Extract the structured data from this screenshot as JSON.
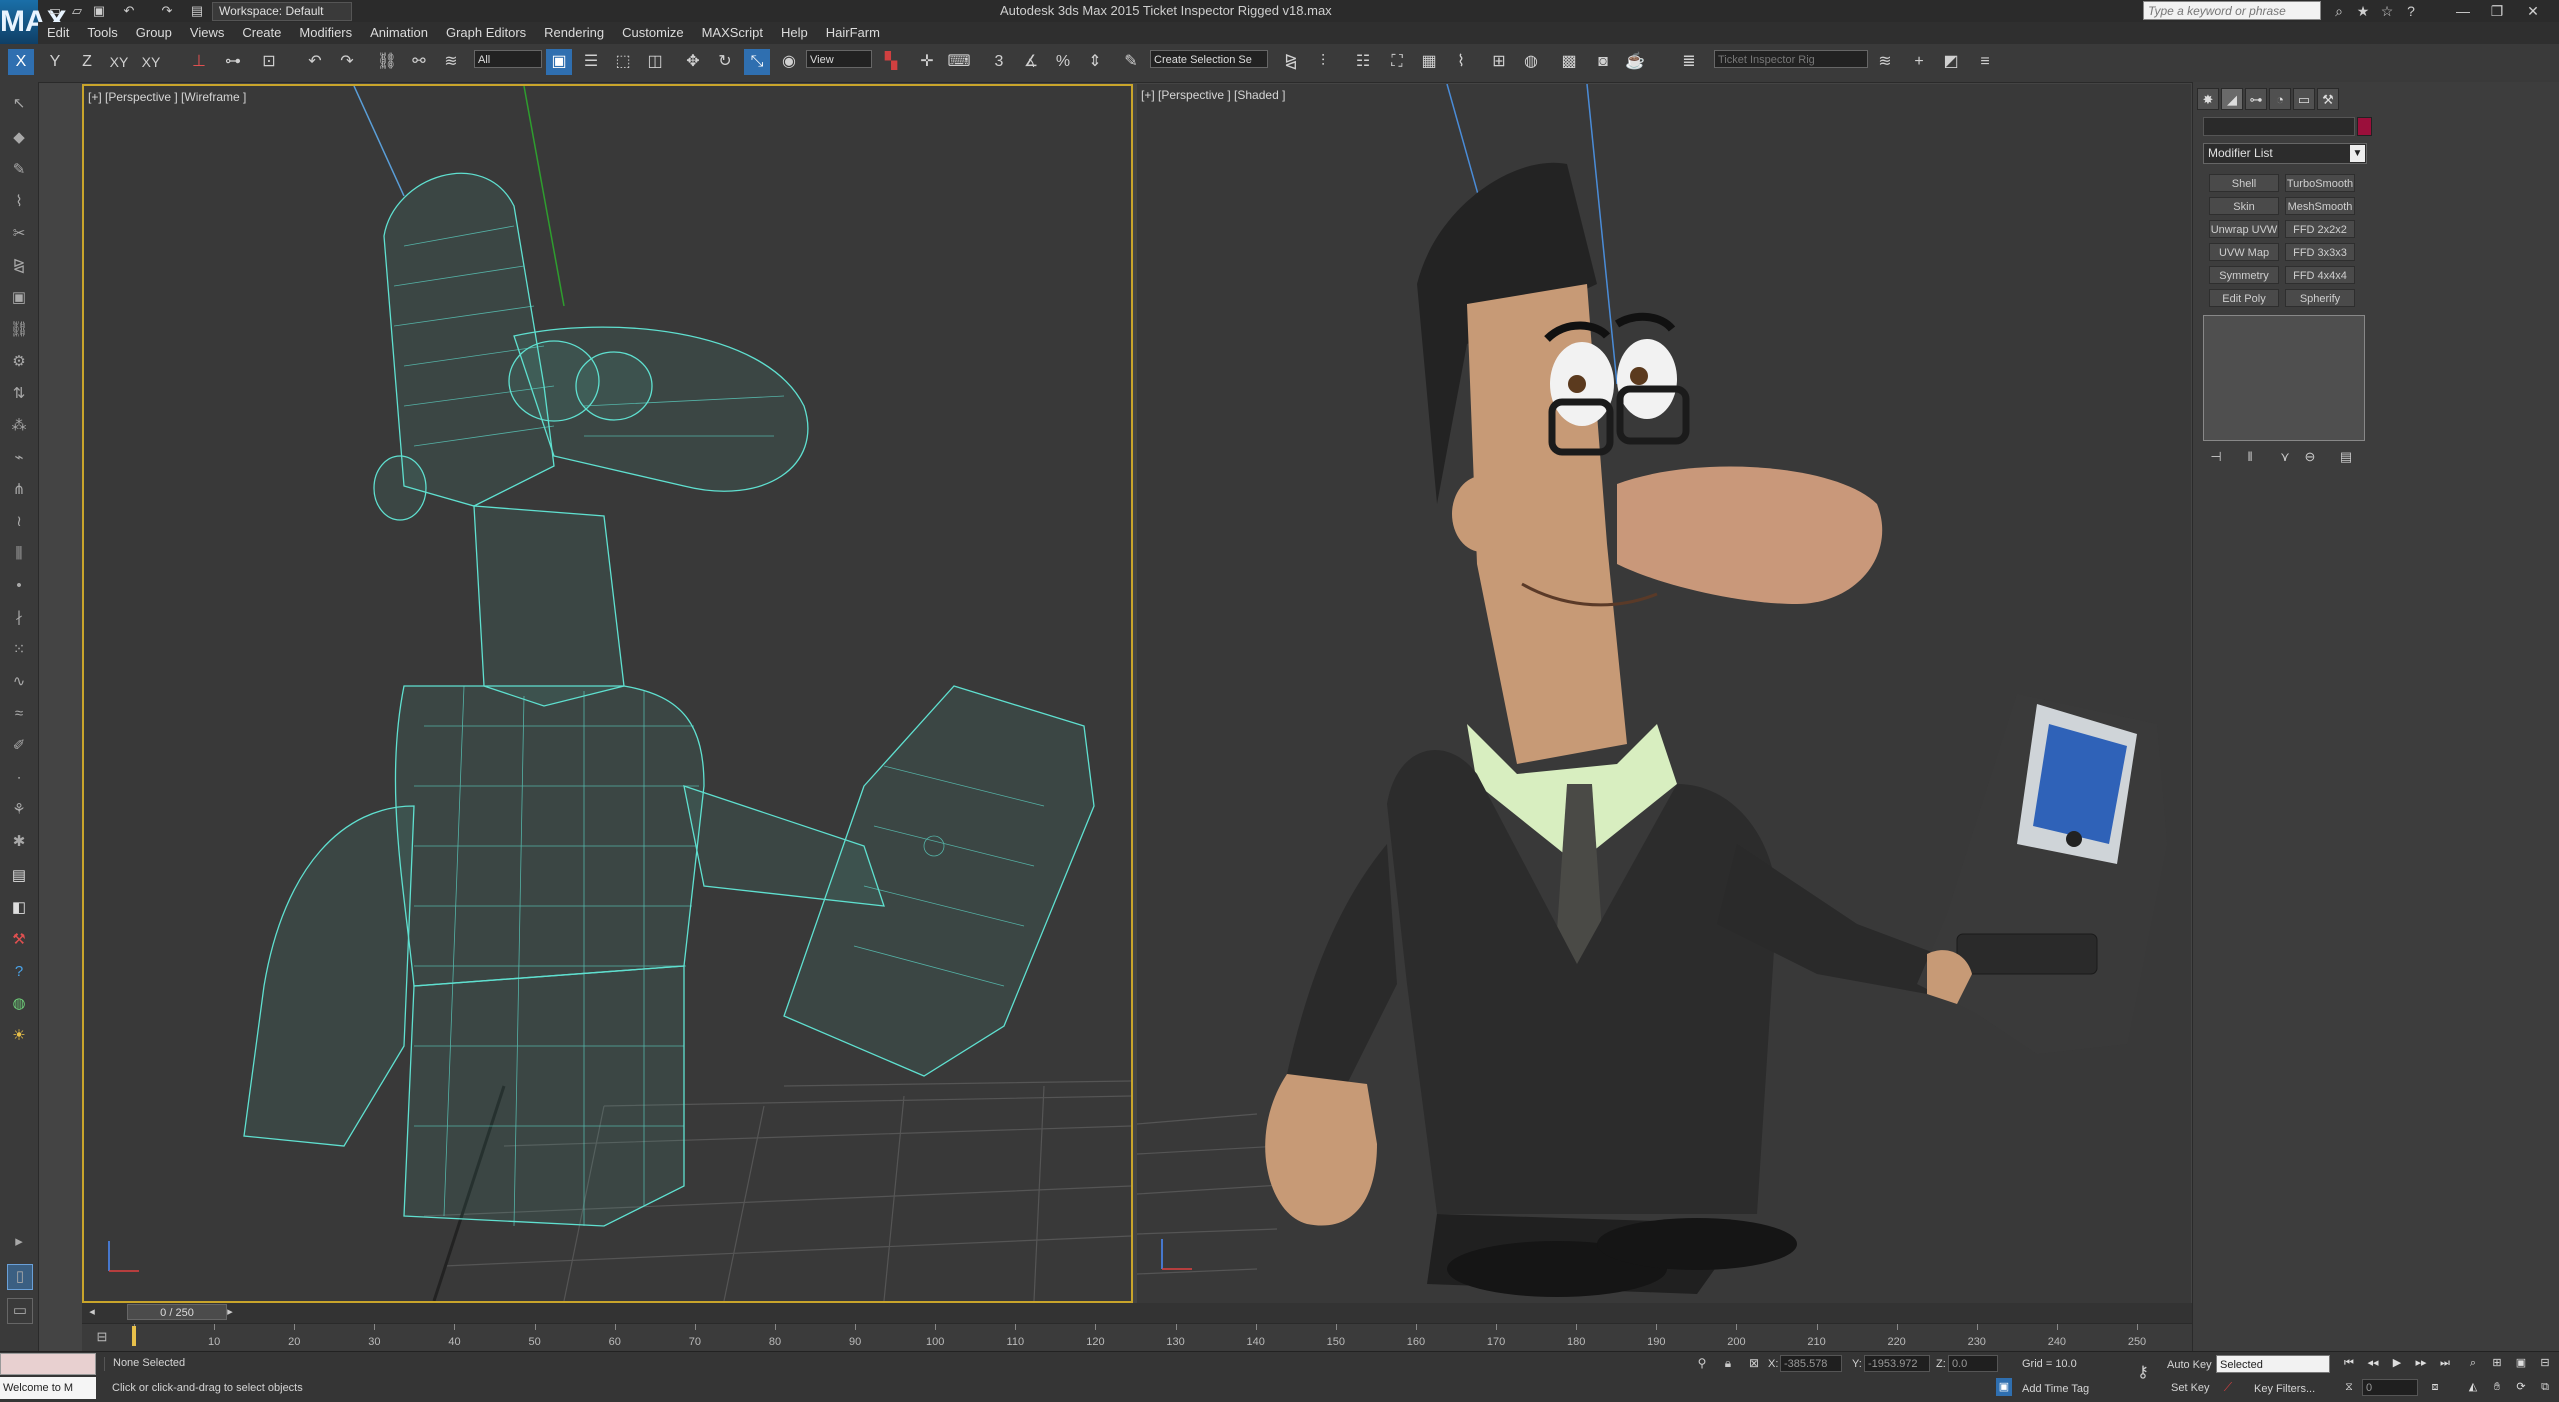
{
  "titlebar": {
    "title": "Autodesk 3ds Max 2015     Ticket Inspector Rigged v18.max",
    "workspace": "Workspace: Default",
    "search_placeholder": "Type a keyword or phrase",
    "logo": "MAX"
  },
  "menu": [
    "Edit",
    "Tools",
    "Group",
    "Views",
    "Create",
    "Modifiers",
    "Animation",
    "Graph Editors",
    "Rendering",
    "Customize",
    "MAXScript",
    "Help",
    "HairFarm"
  ],
  "toolbar": {
    "axes": [
      "X",
      "Y",
      "Z",
      "XY",
      "XY"
    ],
    "selection_filter": "All",
    "reference_coord": "View",
    "named_selection": "Create Selection Se",
    "layer_field": "Ticket Inspector Rig"
  },
  "viewports": {
    "left_label": "[+] [Perspective ] [Wireframe ]",
    "right_label": "[+] [Perspective ] [Shaded ]"
  },
  "command_panel": {
    "modifier_list": "Modifier List",
    "object_color": "#9b0f3b",
    "modifier_buttons": [
      [
        "Shell",
        "TurboSmooth"
      ],
      [
        "Skin",
        "MeshSmooth"
      ],
      [
        "Unwrap UVW",
        "FFD 2x2x2"
      ],
      [
        "UVW Map",
        "FFD 3x3x3"
      ],
      [
        "Symmetry",
        "FFD 4x4x4"
      ],
      [
        "Edit Poly",
        "Spherify"
      ]
    ]
  },
  "timeline": {
    "frame": "0 / 250",
    "ticks": [
      "0",
      "10",
      "20",
      "30",
      "40",
      "50",
      "60",
      "70",
      "80",
      "90",
      "100",
      "110",
      "120",
      "130",
      "140",
      "150",
      "160",
      "170",
      "180",
      "190",
      "200",
      "210",
      "220",
      "230",
      "240",
      "250"
    ]
  },
  "status": {
    "selection": "None Selected",
    "prompt": "Click or click-and-drag to select objects",
    "welcome": "Welcome to M",
    "x_label": "X:",
    "x_value": "-385.578",
    "y_label": "Y:",
    "y_value": "-1953.972",
    "z_label": "Z:",
    "z_value": "0.0",
    "grid": "Grid = 10.0",
    "add_time_tag": "Add Time Tag",
    "auto_key": "Auto Key",
    "set_key": "Set Key",
    "key_mode": "Selected",
    "key_filters": "Key Filters...",
    "frame_field": "0"
  },
  "colors": {
    "wireframe": "#5fe0d0",
    "viewport_bg": "#393939",
    "active_border": "#c9a52b"
  }
}
